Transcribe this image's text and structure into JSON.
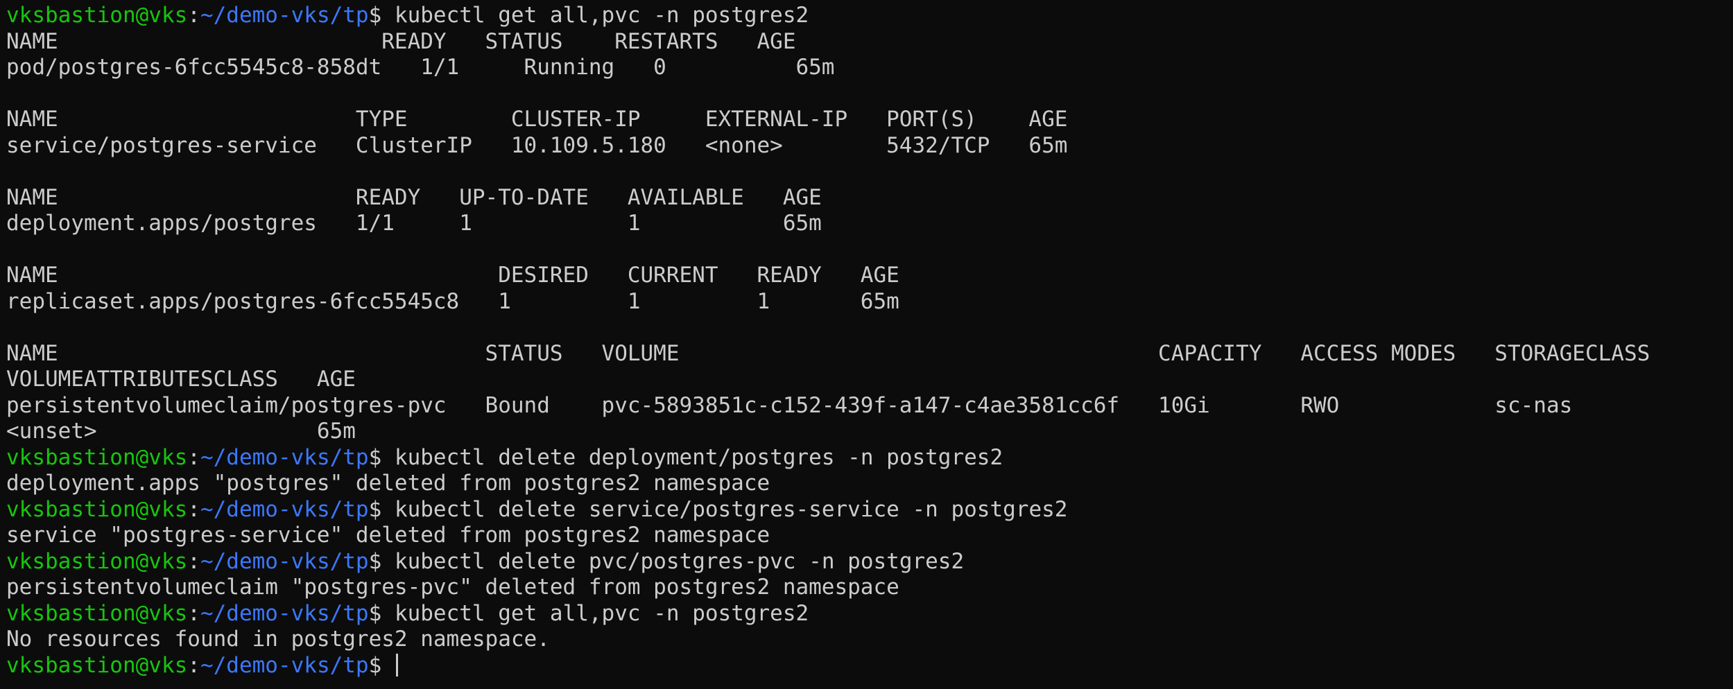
{
  "terminal": {
    "prompt_user": "vksbastion@vks",
    "prompt_sep": ":",
    "prompt_path": "~/demo-vks/tp",
    "prompt_symbol": "$ ",
    "colors": {
      "background": "#0c0c0c",
      "foreground": "#cccccc",
      "user": "#16c60c",
      "path": "#3b78ff"
    },
    "lines": [
      {
        "type": "prompt",
        "cmd": "kubectl get all,pvc -n postgres2"
      },
      {
        "type": "out",
        "text": "NAME                         READY   STATUS    RESTARTS   AGE"
      },
      {
        "type": "out",
        "text": "pod/postgres-6fcc5545c8-858dt   1/1     Running   0          65m"
      },
      {
        "type": "out",
        "text": ""
      },
      {
        "type": "out",
        "text": "NAME                       TYPE        CLUSTER-IP     EXTERNAL-IP   PORT(S)    AGE"
      },
      {
        "type": "out",
        "text": "service/postgres-service   ClusterIP   10.109.5.180   <none>        5432/TCP   65m"
      },
      {
        "type": "out",
        "text": ""
      },
      {
        "type": "out",
        "text": "NAME                       READY   UP-TO-DATE   AVAILABLE   AGE"
      },
      {
        "type": "out",
        "text": "deployment.apps/postgres   1/1     1            1           65m"
      },
      {
        "type": "out",
        "text": ""
      },
      {
        "type": "out",
        "text": "NAME                                  DESIRED   CURRENT   READY   AGE"
      },
      {
        "type": "out",
        "text": "replicaset.apps/postgres-6fcc5545c8   1         1         1       65m"
      },
      {
        "type": "out",
        "text": ""
      },
      {
        "type": "out",
        "text": "NAME                                 STATUS   VOLUME                                     CAPACITY   ACCESS MODES   STORAGECLASS"
      },
      {
        "type": "out",
        "text": "VOLUMEATTRIBUTESCLASS   AGE"
      },
      {
        "type": "out",
        "text": "persistentvolumeclaim/postgres-pvc   Bound    pvc-5893851c-c152-439f-a147-c4ae3581cc6f   10Gi       RWO            sc-nas"
      },
      {
        "type": "out",
        "text": "<unset>                 65m"
      },
      {
        "type": "prompt",
        "cmd": "kubectl delete deployment/postgres -n postgres2"
      },
      {
        "type": "out",
        "text": "deployment.apps \"postgres\" deleted from postgres2 namespace"
      },
      {
        "type": "prompt",
        "cmd": "kubectl delete service/postgres-service -n postgres2"
      },
      {
        "type": "out",
        "text": "service \"postgres-service\" deleted from postgres2 namespace"
      },
      {
        "type": "prompt",
        "cmd": "kubectl delete pvc/postgres-pvc -n postgres2"
      },
      {
        "type": "out",
        "text": "persistentvolumeclaim \"postgres-pvc\" deleted from postgres2 namespace"
      },
      {
        "type": "prompt",
        "cmd": "kubectl get all,pvc -n postgres2"
      },
      {
        "type": "out",
        "text": "No resources found in postgres2 namespace."
      },
      {
        "type": "prompt",
        "cmd": "",
        "cursor": true
      }
    ]
  }
}
